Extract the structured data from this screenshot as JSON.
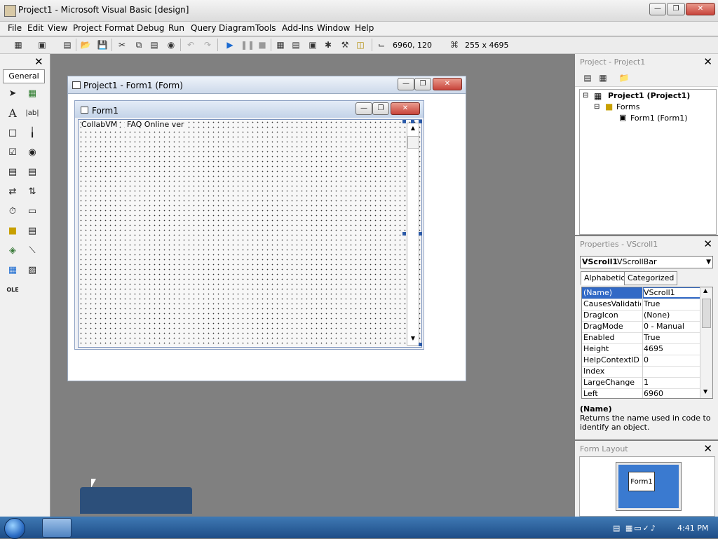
{
  "window": {
    "title": "Project1 - Microsoft Visual Basic [design]"
  },
  "menubar": {
    "items": [
      "File",
      "Edit",
      "View",
      "Project",
      "Format",
      "Debug",
      "Run",
      "Query",
      "Diagram",
      "Tools",
      "Add-Ins",
      "Window",
      "Help"
    ]
  },
  "toolbar": {
    "position_readout": "6960, 120",
    "size_readout": "255 x 4695"
  },
  "toolbox": {
    "tab_label": "General"
  },
  "form_window": {
    "title": "Project1 - Form1 (Form)"
  },
  "form": {
    "title": "Form1",
    "label1": "CollabVM",
    "label2": "FAQ Online ver"
  },
  "project_panel": {
    "title": "Project - Project1",
    "root": "Project1 (Project1)",
    "folder": "Forms",
    "item": "Form1 (Form1)"
  },
  "properties_panel": {
    "title": "Properties - VScroll1",
    "object_name": "VScroll1",
    "object_type": "VScrollBar",
    "tab_alphabetic": "Alphabetic",
    "tab_categorized": "Categorized",
    "rows": [
      {
        "k": "(Name)",
        "v": "VScroll1"
      },
      {
        "k": "CausesValidation",
        "v": "True"
      },
      {
        "k": "DragIcon",
        "v": "(None)"
      },
      {
        "k": "DragMode",
        "v": "0 - Manual"
      },
      {
        "k": "Enabled",
        "v": "True"
      },
      {
        "k": "Height",
        "v": "4695"
      },
      {
        "k": "HelpContextID",
        "v": "0"
      },
      {
        "k": "Index",
        "v": ""
      },
      {
        "k": "LargeChange",
        "v": "1"
      },
      {
        "k": "Left",
        "v": "6960"
      }
    ],
    "desc_title": "(Name)",
    "desc_text": "Returns the name used in code to identify an object."
  },
  "layout_panel": {
    "title": "Form Layout",
    "mini_label": "Form1"
  },
  "taskbar": {
    "clock": "4:41 PM"
  },
  "colors": {
    "selection": "#3169c6",
    "taskbar": "#1e4d87"
  }
}
